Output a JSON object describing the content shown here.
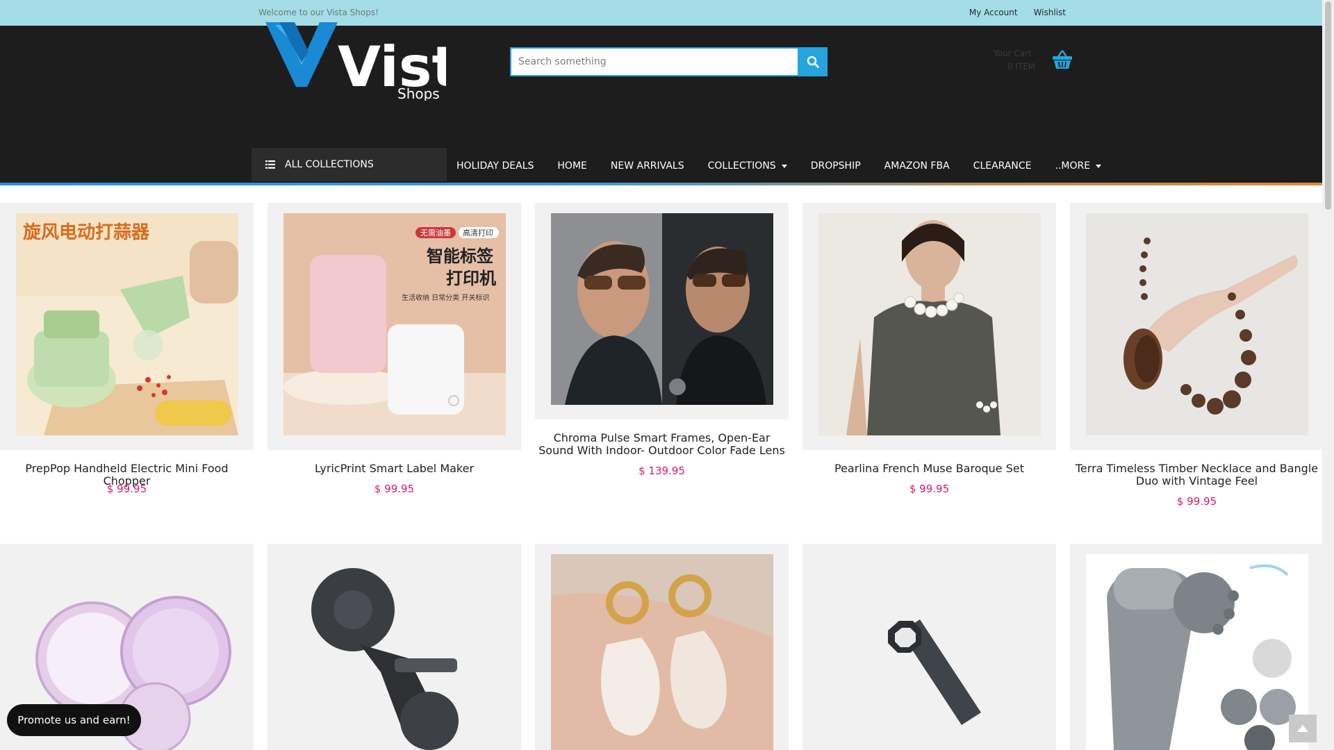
{
  "topbar": {
    "welcome": "Welcome to our Vista Shops!",
    "my_account": "My Account",
    "wishlist": "Wishlist"
  },
  "logo": {
    "main": "Vista",
    "sub": "Shops"
  },
  "search": {
    "placeholder": "Search something",
    "value": "",
    "icon": "search-icon"
  },
  "cart": {
    "label": "Your Cart",
    "items": "0 ITEM",
    "icon": "basket-icon"
  },
  "nav": {
    "all_collections": "ALL COLLECTIONS",
    "items": [
      {
        "label": "HOLIDAY DEALS"
      },
      {
        "label": "HOME"
      },
      {
        "label": "NEW ARRIVALS"
      },
      {
        "label": "COLLECTIONS"
      },
      {
        "label": "DROPSHIP"
      },
      {
        "label": "AMAZON FBA"
      },
      {
        "label": "CLEARANCE"
      },
      {
        "label": "..MORE"
      }
    ]
  },
  "products": [
    {
      "name": "PrepPop Handheld Electric Mini Food Chopper",
      "price": "$ 99.95"
    },
    {
      "name": "LyricPrint Smart Label Maker",
      "price": "$ 99.95"
    },
    {
      "name": "Chroma Pulse Smart Frames, Open-Ear Sound With Indoor- Outdoor Color Fade Lens",
      "price": "$ 139.95"
    },
    {
      "name": "Pearlina French Muse Baroque Set",
      "price": "$ 99.95"
    },
    {
      "name": "Terra Timeless Timber Necklace and Bangle Duo with Vintage Feel",
      "price": "$ 99.95"
    }
  ],
  "product_images_cn": {
    "chopper_title": "旋风电动打蒜器",
    "label_tag_1": "无需油墨",
    "label_tag_2": "高清打印",
    "label_title_1": "智能标签",
    "label_title_2": "打印机",
    "label_sub": "生活收纳 日常分类 开关标识"
  },
  "promote": "Promote us and earn!",
  "colors": {
    "topbar": "#a4dde6",
    "header": "#1d1d1d",
    "accent": "#26a4e0",
    "price": "#d2186e"
  }
}
